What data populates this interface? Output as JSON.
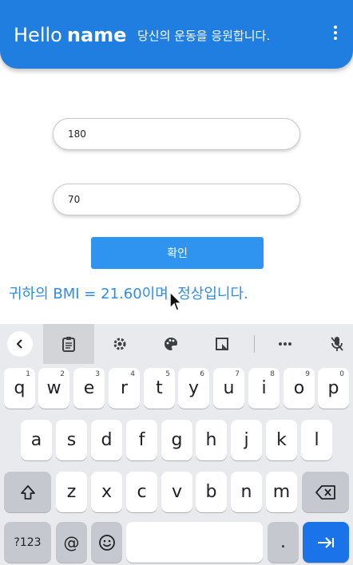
{
  "app_bar": {
    "brand_hello": "Hello",
    "brand_name": "name",
    "subtitle": "당신의 운동을 응원합니다.",
    "menu_icon": "more-vert-icon",
    "color": "#1f7ee0"
  },
  "form": {
    "height_value": "180",
    "weight_value": "70",
    "confirm_label": "확인",
    "result_text": "귀하의 BMI = 21.60이며, 정상입니다."
  },
  "keyboard": {
    "toolbar": [
      "back-icon",
      "clipboard-icon",
      "settings-icon",
      "palette-icon",
      "screenshot-edit-icon",
      "more-horiz-icon",
      "mic-off-icon"
    ],
    "row1": [
      {
        "label": "q",
        "sup": "1"
      },
      {
        "label": "w",
        "sup": "2"
      },
      {
        "label": "e",
        "sup": "3"
      },
      {
        "label": "r",
        "sup": "4"
      },
      {
        "label": "t",
        "sup": "5"
      },
      {
        "label": "y",
        "sup": "6"
      },
      {
        "label": "u",
        "sup": "7"
      },
      {
        "label": "i",
        "sup": "8"
      },
      {
        "label": "o",
        "sup": "9"
      },
      {
        "label": "p",
        "sup": "0"
      }
    ],
    "row2": [
      "a",
      "s",
      "d",
      "f",
      "g",
      "h",
      "j",
      "k",
      "l"
    ],
    "row3": [
      "z",
      "x",
      "c",
      "v",
      "b",
      "n",
      "m"
    ],
    "row4": {
      "symbols": "?123",
      "at": "@",
      "period": "."
    },
    "enter_color": "#1a73e8"
  }
}
